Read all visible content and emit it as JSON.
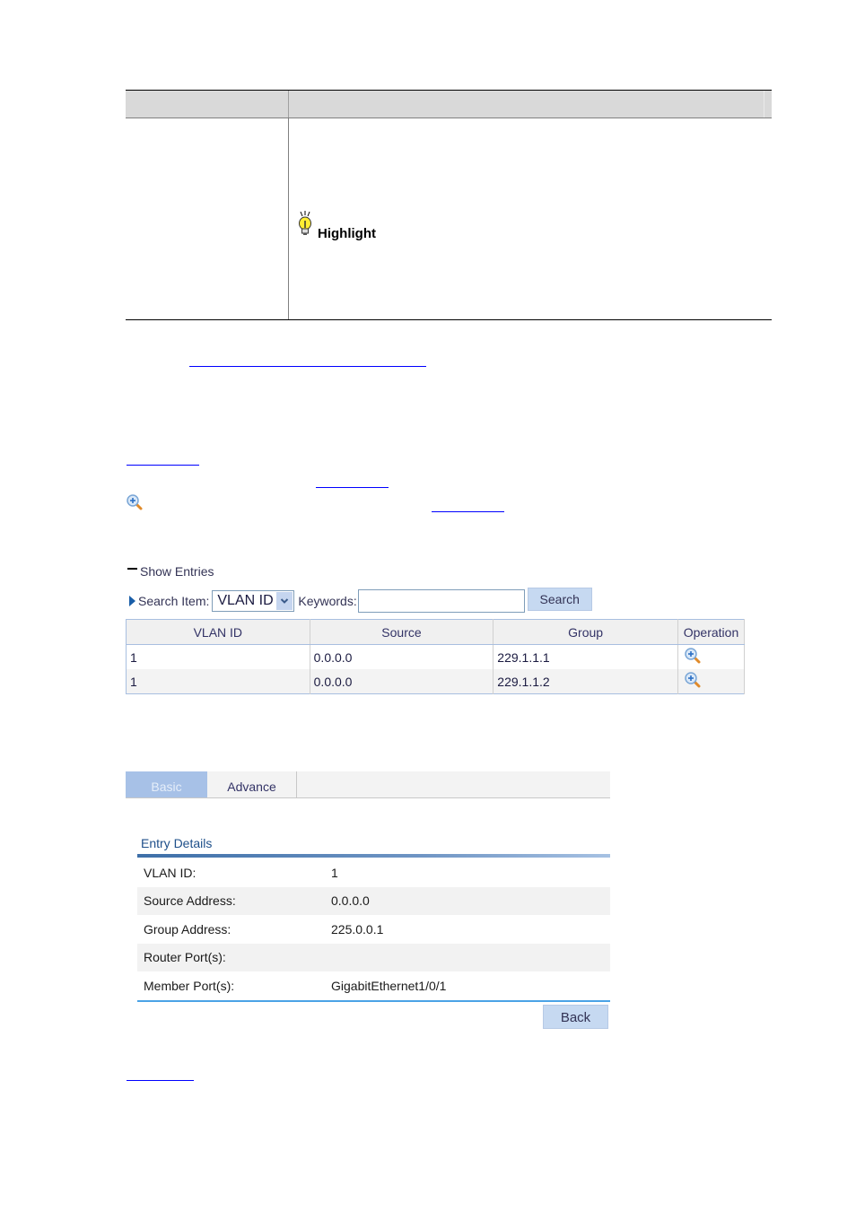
{
  "param_table": {
    "highlight_label": "Highlight"
  },
  "show_entries": {
    "label": "Show Entries",
    "search_item_label": "Search Item:",
    "search_item_selected": "VLAN ID",
    "keywords_label": "Keywords:",
    "keywords_value": "",
    "search_button": "Search"
  },
  "entries_table": {
    "columns": [
      "VLAN ID",
      "Source",
      "Group",
      "Operation"
    ],
    "rows": [
      {
        "vlan_id": "1",
        "source": "0.0.0.0",
        "group": "229.1.1.1",
        "operation_icon": "zoom-in-icon"
      },
      {
        "vlan_id": "1",
        "source": "0.0.0.0",
        "group": "229.1.1.2",
        "operation_icon": "zoom-in-icon"
      }
    ]
  },
  "tabs": [
    {
      "label": "Basic",
      "active": true
    },
    {
      "label": "Advance",
      "active": false
    }
  ],
  "entry_details": {
    "title": "Entry Details",
    "fields": [
      {
        "label": "VLAN ID:",
        "value": "1"
      },
      {
        "label": "Source Address:",
        "value": "0.0.0.0"
      },
      {
        "label": "Group Address:",
        "value": "225.0.0.1"
      },
      {
        "label": "Router Port(s):",
        "value": ""
      },
      {
        "label": "Member Port(s):",
        "value": "GigabitEthernet1/0/1"
      }
    ],
    "back_button": "Back"
  }
}
